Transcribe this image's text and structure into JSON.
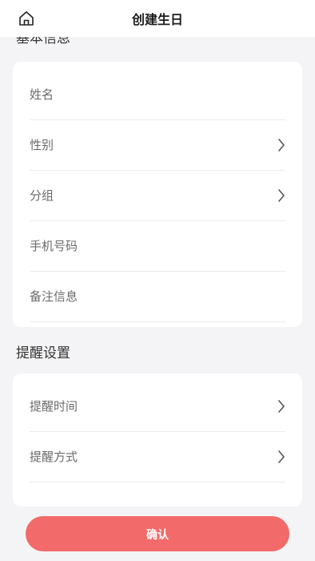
{
  "header": {
    "title": "创建生日",
    "home_icon": "home-icon"
  },
  "sections": {
    "basic": {
      "title": "基本信息",
      "fields": [
        {
          "label": "姓名",
          "chevron": false
        },
        {
          "label": "性别",
          "chevron": true
        },
        {
          "label": "分组",
          "chevron": true
        },
        {
          "label": "手机号码",
          "chevron": false
        },
        {
          "label": "备注信息",
          "chevron": false
        }
      ]
    },
    "reminder": {
      "title": "提醒设置",
      "fields": [
        {
          "label": "提醒时间",
          "chevron": true
        },
        {
          "label": "提醒方式",
          "chevron": true
        }
      ]
    }
  },
  "confirm_label": "确认",
  "colors": {
    "accent": "#f26a6a",
    "background": "#f4f4f6",
    "card": "#ffffff"
  }
}
